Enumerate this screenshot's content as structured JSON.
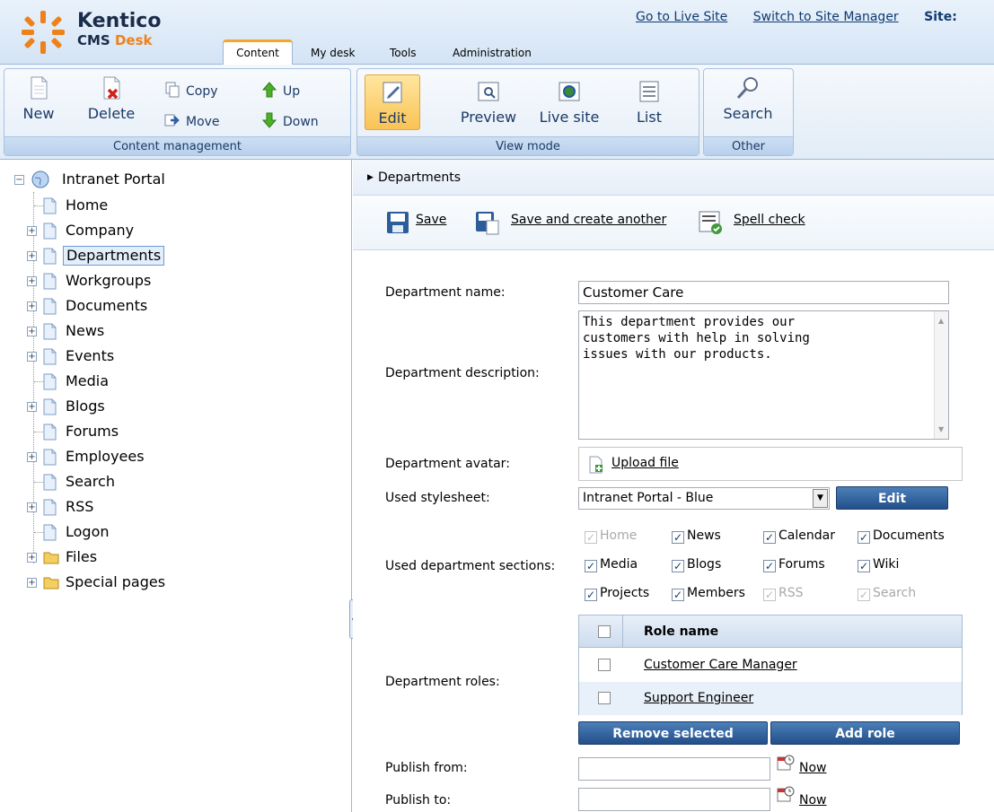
{
  "header": {
    "brand_line1": "Kentico",
    "brand_cms": "CMS",
    "brand_desk": "Desk",
    "links": [
      "Go to Live Site",
      "Switch to Site Manager"
    ],
    "site_label": "Site:",
    "tabs": [
      "Content",
      "My desk",
      "Tools",
      "Administration"
    ],
    "active_tab": "Content"
  },
  "toolbar": {
    "content_management": {
      "title": "Content management",
      "new": "New",
      "delete": "Delete",
      "copy": "Copy",
      "move": "Move",
      "up": "Up",
      "down": "Down"
    },
    "view_mode": {
      "title": "View mode",
      "edit": "Edit",
      "preview": "Preview",
      "live_site": "Live site",
      "list": "List"
    },
    "other": {
      "title": "Other",
      "search": "Search"
    }
  },
  "tree": {
    "root": "Intranet Portal",
    "items": [
      {
        "label": "Home",
        "expandable": false
      },
      {
        "label": "Company",
        "expandable": true
      },
      {
        "label": "Departments",
        "expandable": true,
        "selected": true
      },
      {
        "label": "Workgroups",
        "expandable": true
      },
      {
        "label": "Documents",
        "expandable": true
      },
      {
        "label": "News",
        "expandable": true
      },
      {
        "label": "Events",
        "expandable": true
      },
      {
        "label": "Media",
        "expandable": false
      },
      {
        "label": "Blogs",
        "expandable": true
      },
      {
        "label": "Forums",
        "expandable": false
      },
      {
        "label": "Employees",
        "expandable": true
      },
      {
        "label": "Search",
        "expandable": false
      },
      {
        "label": "RSS",
        "expandable": true
      },
      {
        "label": "Logon",
        "expandable": false
      },
      {
        "label": "Files",
        "expandable": true,
        "folder": true
      },
      {
        "label": "Special pages",
        "expandable": true,
        "folder": true
      }
    ]
  },
  "breadcrumb": "Departments",
  "actions": {
    "save": "Save",
    "save_create_another": "Save and create another",
    "spell_check": "Spell check"
  },
  "form": {
    "name_label": "Department name:",
    "name_value": "Customer Care",
    "desc_label": "Department description:",
    "desc_value": "This department provides our\ncustomers with help in solving\nissues with our products.",
    "avatar_label": "Department avatar:",
    "upload_file": "Upload file",
    "stylesheet_label": "Used stylesheet:",
    "stylesheet_value": "Intranet Portal - Blue",
    "stylesheet_edit": "Edit",
    "sections_label": "Used department sections:",
    "sections": [
      {
        "label": "Home",
        "checked": true,
        "disabled": true
      },
      {
        "label": "News",
        "checked": true,
        "disabled": false
      },
      {
        "label": "Calendar",
        "checked": true,
        "disabled": false
      },
      {
        "label": "Documents",
        "checked": true,
        "disabled": false
      },
      {
        "label": "Media",
        "checked": true,
        "disabled": false
      },
      {
        "label": "Blogs",
        "checked": true,
        "disabled": false
      },
      {
        "label": "Forums",
        "checked": true,
        "disabled": false
      },
      {
        "label": "Wiki",
        "checked": true,
        "disabled": false
      },
      {
        "label": "Projects",
        "checked": true,
        "disabled": false
      },
      {
        "label": "Members",
        "checked": true,
        "disabled": false
      },
      {
        "label": "RSS",
        "checked": true,
        "disabled": true
      },
      {
        "label": "Search",
        "checked": true,
        "disabled": true
      }
    ],
    "roles_label": "Department roles:",
    "roles_header": "Role name",
    "roles": [
      "Customer Care Manager",
      "Support Engineer"
    ],
    "remove_selected": "Remove selected",
    "add_role": "Add role",
    "publish_from_label": "Publish from:",
    "publish_to_label": "Publish to:",
    "now": "Now"
  }
}
